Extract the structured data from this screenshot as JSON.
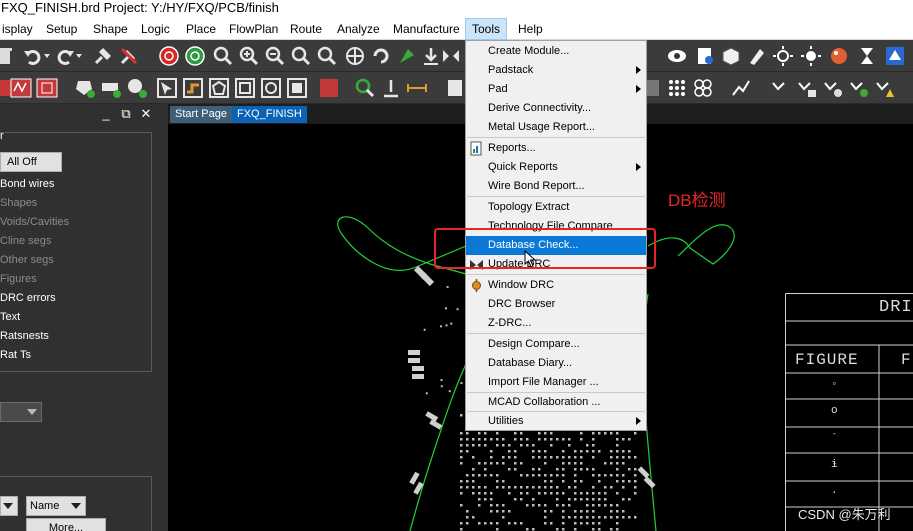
{
  "title": "FXQ_FINISH.brd  Project: Y:/HY/FXQ/PCB/finish",
  "menubar": [
    {
      "label": "isplay"
    },
    {
      "label": "Setup"
    },
    {
      "label": "Shape"
    },
    {
      "label": "Logic"
    },
    {
      "label": "Place"
    },
    {
      "label": "FlowPlan"
    },
    {
      "label": "Route"
    },
    {
      "label": "Analyze"
    },
    {
      "label": "Manufacture"
    },
    {
      "label": "Tools"
    },
    {
      "label": "Help"
    }
  ],
  "left_panel": {
    "header_label": "r",
    "all_off": "All Off",
    "items": [
      {
        "label": "Bond wires"
      },
      {
        "label": "Shapes"
      },
      {
        "label": "Voids/Cavities"
      },
      {
        "label": "Cline segs"
      },
      {
        "label": "Other segs"
      },
      {
        "label": "Figures"
      },
      {
        "label": "DRC errors"
      },
      {
        "label": "Text"
      },
      {
        "label": "Ratsnests"
      },
      {
        "label": "Rat Ts"
      }
    ],
    "sort_select": "Name",
    "more_button": "More..."
  },
  "tabs": [
    {
      "label": "Start Page"
    },
    {
      "label": "FXQ_FINISH"
    }
  ],
  "tools_menu": {
    "items": [
      {
        "label": "Create Module..."
      },
      {
        "label": "Padstack"
      },
      {
        "label": "Pad"
      },
      {
        "label": "Derive Connectivity..."
      },
      {
        "label": "Metal Usage Report..."
      },
      {
        "label": "Reports..."
      },
      {
        "label": "Quick Reports"
      },
      {
        "label": "Wire Bond Report..."
      },
      {
        "label": "Topology Extract"
      },
      {
        "label": "Technology File Compare"
      },
      {
        "label": "Database Check..."
      },
      {
        "label": "Update DRC"
      },
      {
        "label": "Window DRC"
      },
      {
        "label": "DRC Browser"
      },
      {
        "label": "Z-DRC..."
      },
      {
        "label": "Design Compare..."
      },
      {
        "label": "Database Diary..."
      },
      {
        "label": "Import File Manager ..."
      },
      {
        "label": "MCAD Collaboration ..."
      },
      {
        "label": "Utilities"
      }
    ]
  },
  "annotation": "DB检测",
  "title_block": {
    "heading": "DRI",
    "col1": "FIGURE",
    "col2": "F",
    "rows": [
      "◦",
      "o",
      "ˊ",
      "ɨ",
      "."
    ]
  },
  "watermark": "CSDN @朱万利",
  "colors": {
    "menu_highlight": "#0a78d7",
    "annotation_red": "#e8262a",
    "board_outline": "#1fd23a",
    "tab_active": "#0a63b5"
  }
}
